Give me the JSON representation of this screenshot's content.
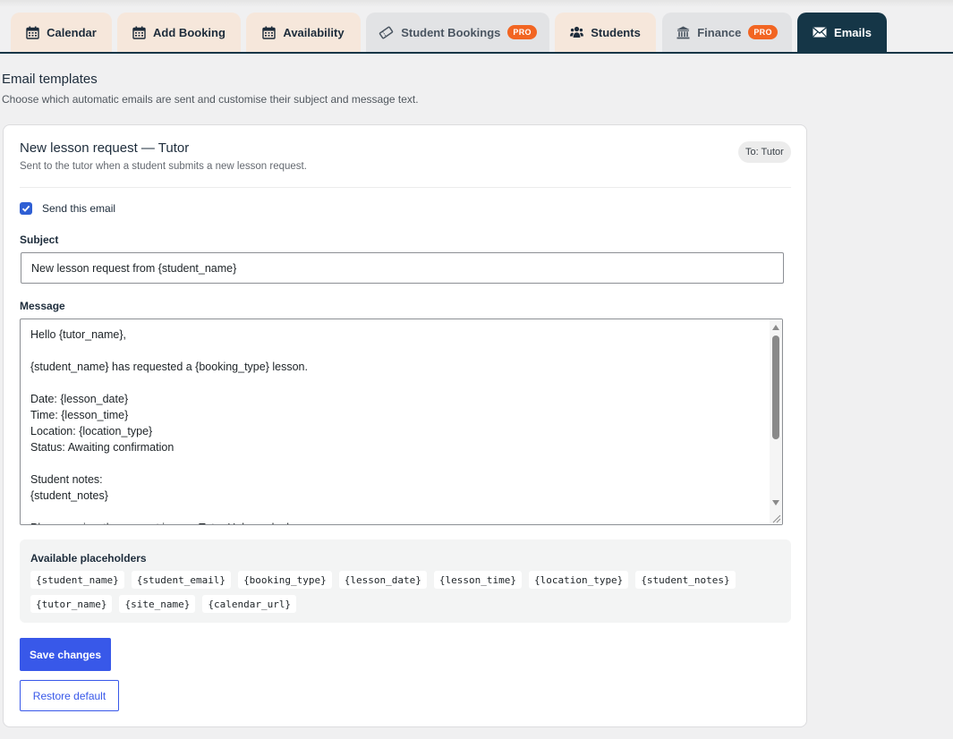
{
  "tabs": [
    {
      "label": "Calendar",
      "icon": "calendar-icon",
      "pro": false,
      "active": false
    },
    {
      "label": "Add Booking",
      "icon": "calendar-icon",
      "pro": false,
      "active": false
    },
    {
      "label": "Availability",
      "icon": "calendar-icon",
      "pro": false,
      "active": false
    },
    {
      "label": "Student Bookings",
      "icon": "ticket-icon",
      "pro": true,
      "active": false
    },
    {
      "label": "Students",
      "icon": "users-icon",
      "pro": false,
      "active": false
    },
    {
      "label": "Finance",
      "icon": "bank-icon",
      "pro": true,
      "active": false
    },
    {
      "label": "Emails",
      "icon": "envelope-icon",
      "pro": false,
      "active": true
    }
  ],
  "pro_label": "PRO",
  "page": {
    "title": "Email templates",
    "description": "Choose which automatic emails are sent and customise their subject and message text."
  },
  "template": {
    "title": "New lesson request — Tutor",
    "description": "Sent to the tutor when a student submits a new lesson request.",
    "recipient_badge": "To: Tutor",
    "send_label": "Send this email",
    "send_enabled": true,
    "subject_label": "Subject",
    "subject_value": "New lesson request from {student_name}",
    "message_label": "Message",
    "message_value": "Hello {tutor_name},\n\n{student_name} has requested a {booking_type} lesson.\n\nDate: {lesson_date}\nTime: {lesson_time}\nLocation: {location_type}\nStatus: Awaiting confirmation\n\nStudent notes:\n{student_notes}\n\nPlease review the request in your Tutor Hub; we look",
    "placeholders_title": "Available placeholders",
    "placeholders": [
      "{student_name}",
      "{student_email}",
      "{booking_type}",
      "{lesson_date}",
      "{lesson_time}",
      "{location_type}",
      "{student_notes}",
      "{tutor_name}",
      "{site_name}",
      "{calendar_url}"
    ],
    "save_label": "Save changes",
    "restore_label": "Restore default"
  },
  "colors": {
    "tab_inactive": "#f6e7db",
    "tab_pro_inactive": "#e2e3e5",
    "tab_active": "#153647",
    "pro_badge": "#f26522",
    "primary": "#3858e9"
  }
}
